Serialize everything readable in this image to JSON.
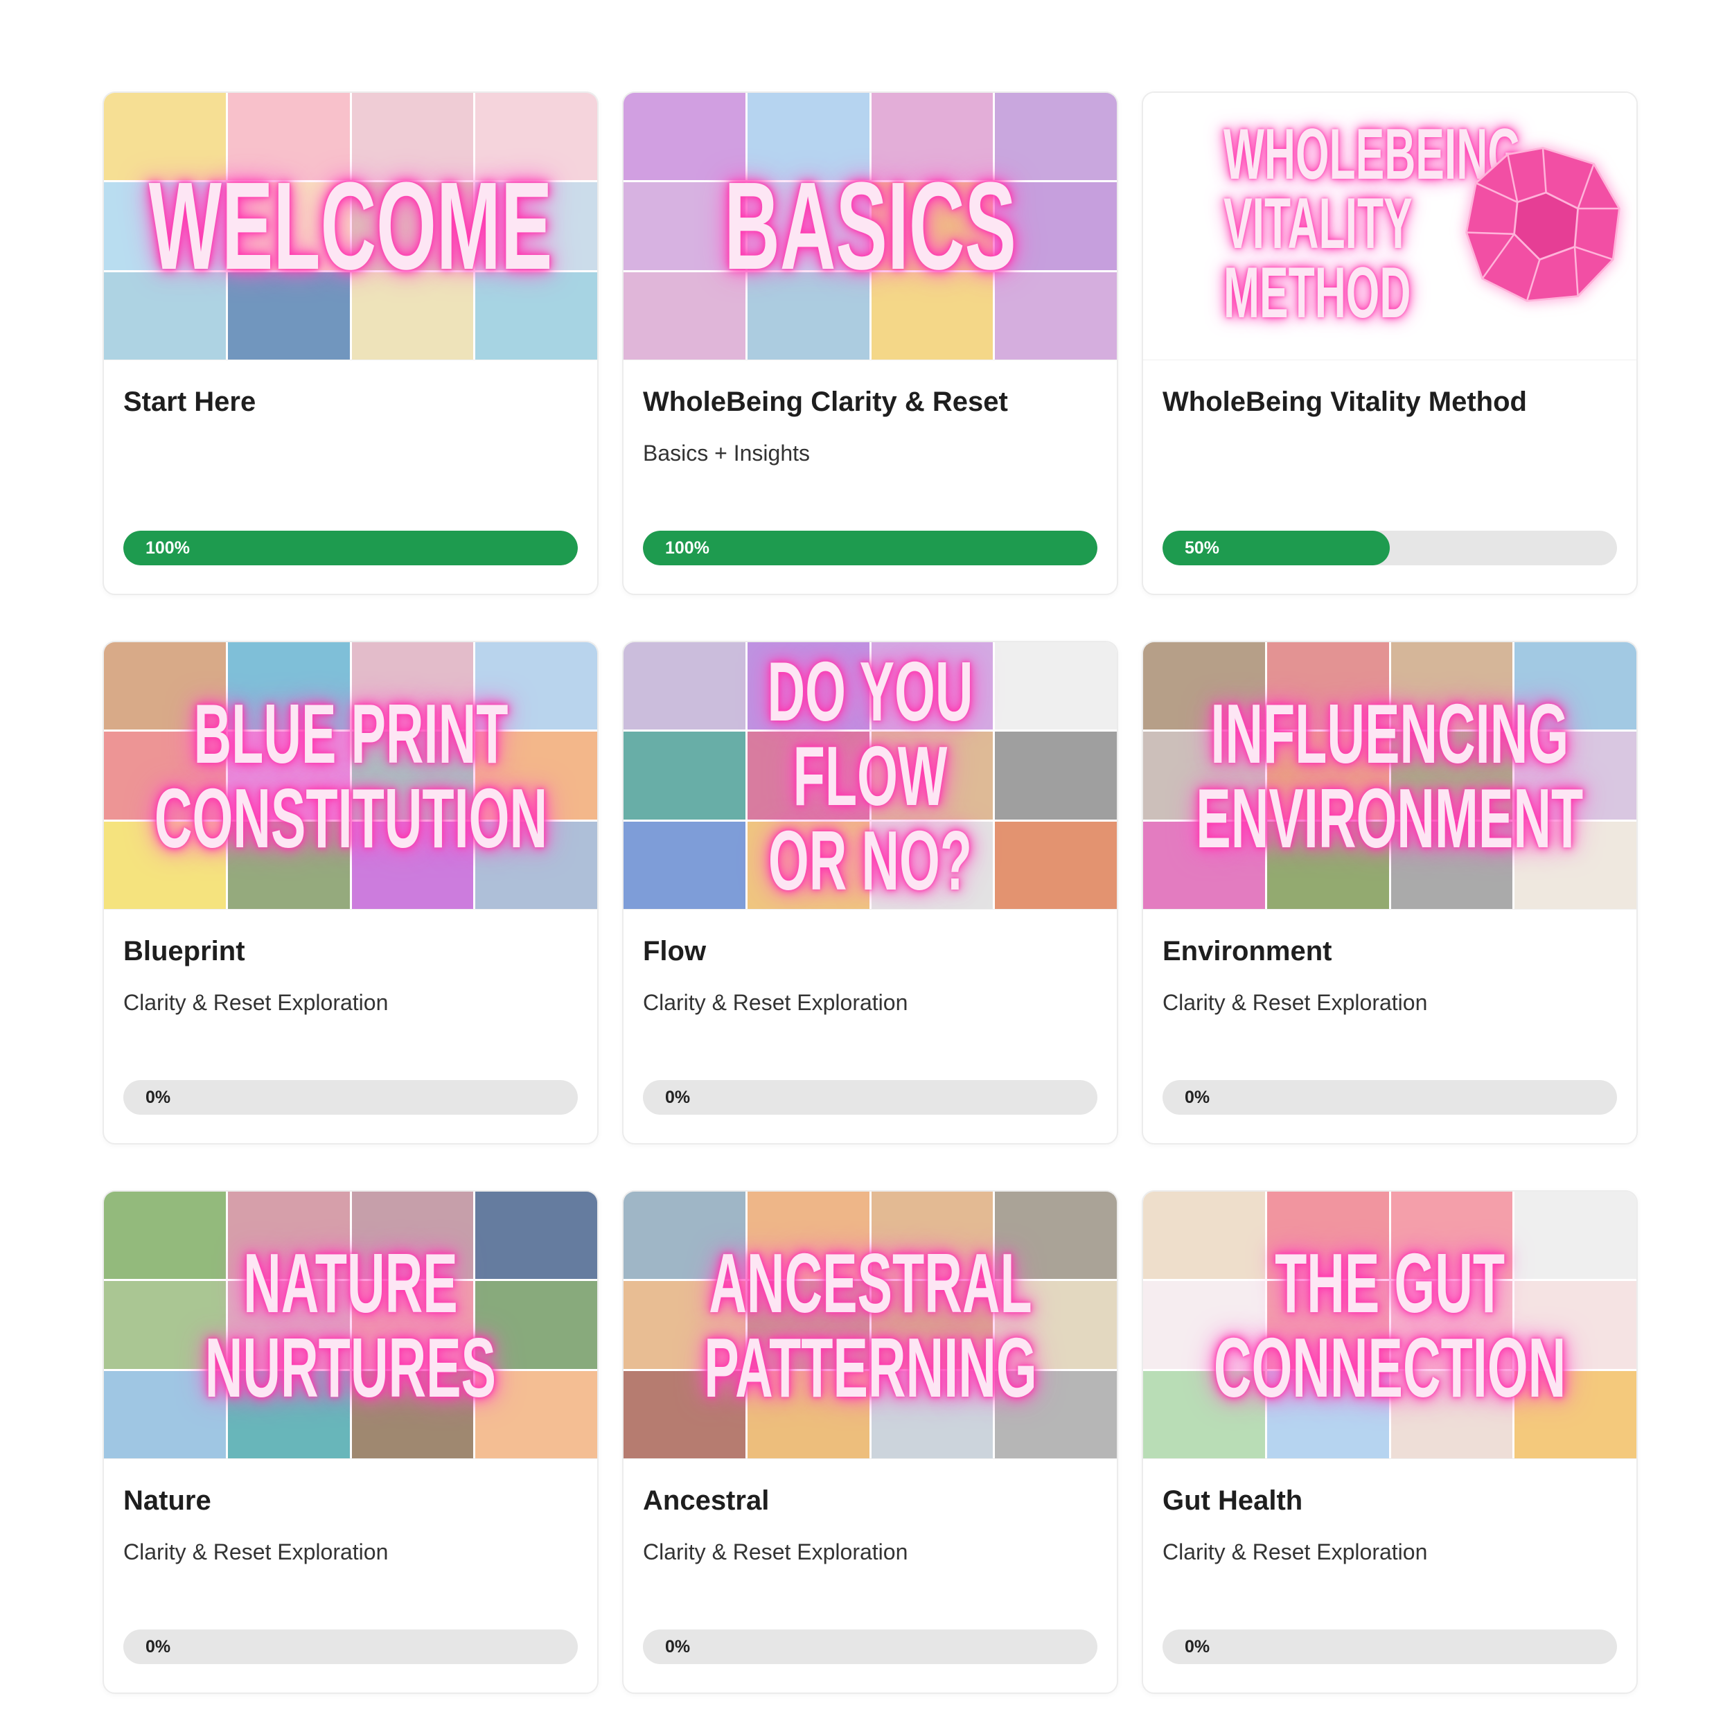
{
  "colors": {
    "progress_fill": "#1e9b4f",
    "progress_track": "#e6e6e6",
    "glow_pink": "#ff2fa6"
  },
  "cards": [
    {
      "overlay": "WELCOME",
      "title": "Start Here",
      "subtitle": "",
      "progress": 100,
      "progress_label": "100%",
      "palette": [
        "#f3d36b",
        "#f6a9b8",
        "#e9b9c5",
        "#f2c4cf",
        "#9fd0ea",
        "#f5d9a6",
        "#cdb59a",
        "#b7cfe2",
        "#8fc3d9",
        "#3b6ea5",
        "#e8d9a0",
        "#86c4d8"
      ]
    },
    {
      "overlay": "BASICS",
      "title": "WholeBeing Clarity & Reset",
      "subtitle": "Basics + Insights",
      "progress": 100,
      "progress_label": "100%",
      "palette": [
        "#c07ad6",
        "#9ac4ea",
        "#d98fc9",
        "#b586d1",
        "#c895d6",
        "#a8c7e8",
        "#e8b04a",
        "#b07bd0",
        "#d49acb",
        "#8db9d4",
        "#f0c85a",
        "#c58fd1"
      ]
    },
    {
      "overlay": "WHOLEBEING\nVITALITY\nMETHOD",
      "title": "WholeBeing Vitality Method",
      "subtitle": "",
      "progress": 50,
      "progress_label": "50%",
      "gem": "pink-dodecahedron"
    },
    {
      "overlay": "BLUE PRINT\nCONSTITUTION",
      "title": "Blueprint",
      "subtitle": "Clarity & Reset Exploration",
      "progress": 0,
      "progress_label": "0%",
      "palette": [
        "#c98a5a",
        "#4ea7c9",
        "#d9a3b6",
        "#9fc4e6",
        "#e66c6c",
        "#d86fcf",
        "#7fb8a4",
        "#ef9b5d",
        "#f1d84d",
        "#6d8a4c",
        "#b94ad0",
        "#8fa7c9"
      ]
    },
    {
      "overlay": "DO YOU FLOW\nOR NO?",
      "title": "Flow",
      "subtitle": "Clarity & Reset Exploration",
      "progress": 0,
      "progress_label": "0%",
      "palette": [
        "#b8a4cf",
        "#a56ad6",
        "#c28ad8",
        "#e9e9e9",
        "#2f8f86",
        "#c94a7a",
        "#d2a06e",
        "#7a7a7a",
        "#4d78c9",
        "#e9b04e",
        "#d9d9d9",
        "#d86a3a"
      ]
    },
    {
      "overlay": "INFLUENCING\nENVIRONMENT",
      "title": "Environment",
      "subtitle": "Clarity & Reset Exploration",
      "progress": 0,
      "progress_label": "0%",
      "palette": [
        "#9a7a5a",
        "#d86a6a",
        "#c59a72",
        "#7fb4d9",
        "#b9a7a0",
        "#e08a4a",
        "#7a9a4a",
        "#cbb2d6",
        "#d94aa8",
        "#6a8a3a",
        "#8a8a8a",
        "#e9dfd3"
      ]
    },
    {
      "overlay": "NATURE\nNURTURES",
      "title": "Nature",
      "subtitle": "Clarity & Reset Exploration",
      "progress": 0,
      "progress_label": "0%",
      "palette": [
        "#6aa04a",
        "#c77a8a",
        "#b07a8a",
        "#2a4a7a",
        "#8ab06a",
        "#d28aa4",
        "#e87a8a",
        "#5a8a4a",
        "#7ab0d9",
        "#2f9aa0",
        "#7a5a3a",
        "#f0a66a"
      ]
    },
    {
      "overlay": "ANCESTRAL\nPATTERNING",
      "title": "Ancestral",
      "subtitle": "Clarity & Reset Exploration",
      "progress": 0,
      "progress_label": "0%",
      "palette": [
        "#7a9ab0",
        "#e89a5a",
        "#d9a06a",
        "#8a8070",
        "#e0a46a",
        "#b0705a",
        "#c98a5a",
        "#d9c9a8",
        "#9a4a3a",
        "#e6a64a",
        "#b9c4cf",
        "#9a9a9a"
      ]
    },
    {
      "overlay": "THE GUT\nCONNECTION",
      "title": "Gut Health",
      "subtitle": "Clarity & Reset Exploration",
      "progress": 0,
      "progress_label": "0%",
      "palette": [
        "#e8d2b8",
        "#ec6c7a",
        "#f07a8a",
        "#e9e9e9",
        "#f3e6ea",
        "#ee7a8a",
        "#f2a4b4",
        "#f2d9d9",
        "#9ed09a",
        "#9ac4ea",
        "#e8d2c8",
        "#f0b44a"
      ]
    }
  ]
}
